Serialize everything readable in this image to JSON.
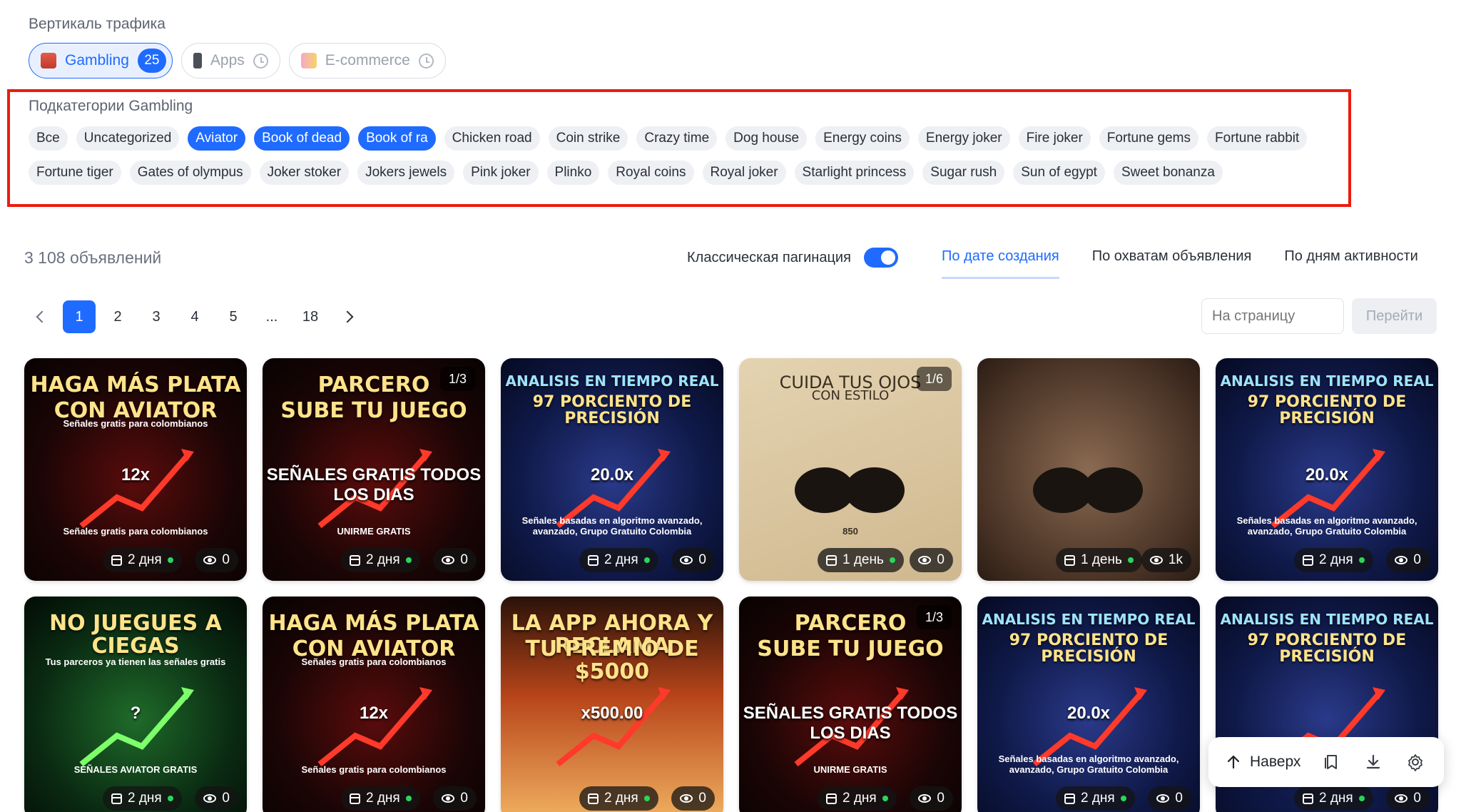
{
  "vertical": {
    "label": "Вертикаль трафика",
    "items": [
      {
        "label": "Gambling",
        "badge": "25",
        "active": true
      },
      {
        "label": "Apps",
        "active": false
      },
      {
        "label": "E-commerce",
        "active": false
      }
    ]
  },
  "subcategories": {
    "label": "Подкатегории Gambling",
    "row1": [
      "Все",
      "Uncategorized",
      "Aviator",
      "Book of dead",
      "Book of ra",
      "Chicken road",
      "Coin strike",
      "Crazy time",
      "Dog house",
      "Energy coins",
      "Energy joker",
      "Fire joker",
      "Fortune gems",
      "Fortune rabbit"
    ],
    "row2": [
      "Fortune tiger",
      "Gates of olympus",
      "Joker stoker",
      "Jokers jewels",
      "Pink joker",
      "Plinko",
      "Royal coins",
      "Royal joker",
      "Starlight princess",
      "Sugar rush",
      "Sun of egypt",
      "Sweet bonanza"
    ],
    "selected": [
      "Aviator",
      "Book of dead",
      "Book of ra"
    ]
  },
  "toolbar": {
    "count": "3 108 объявлений",
    "pagination_label": "Классическая пагинация",
    "pagination_on": true,
    "sort_tabs": [
      "По дате создания",
      "По охватам объявления",
      "По дням активности"
    ],
    "active_sort": "По дате создания"
  },
  "pager": {
    "pages": [
      "1",
      "2",
      "3",
      "4",
      "5",
      "...",
      "18"
    ],
    "current": "1",
    "goto_placeholder": "На страницу",
    "goto_button": "Перейти"
  },
  "cards": [
    {
      "theme": "red",
      "line1": "HAGA MÁS PLATA",
      "line2": "CON AVIATOR",
      "sub": "Señales gratis para colombianos",
      "big": "12x",
      "bottom": "Señales gratis para colombianos",
      "page": "",
      "days": "2 дня",
      "views": "0"
    },
    {
      "theme": "red",
      "line1": "PARCERO",
      "line2": "SUBE TU JUEGO",
      "sub": "",
      "big": "SEÑALES GRATIS TODOS LOS DIAS",
      "bottom": "UNIRME GRATIS",
      "page": "1/3",
      "days": "2 дня",
      "views": "0"
    },
    {
      "theme": "blue",
      "line1": "ANALISIS EN TIEMPO REAL",
      "line2": "97 PORCIENTO DE PRECISIÓN",
      "sub": "",
      "big": "20.0x",
      "bottom": "Señales basadas en algoritmo avanzado, avanzado, Grupo Gratuito Colombia",
      "page": "",
      "days": "2 дня",
      "views": "0"
    },
    {
      "theme": "beige",
      "line1": "CUIDA TUS OJOS",
      "line2": "CON ESTILO",
      "sub": "",
      "big": "",
      "bottom": "850",
      "page": "1/6",
      "days": "1 день",
      "views": "0"
    },
    {
      "theme": "brown",
      "line1": "",
      "line2": "",
      "sub": "",
      "big": "",
      "bottom": "",
      "page": "",
      "days": "1 день",
      "views": "1k"
    },
    {
      "theme": "blue",
      "line1": "ANALISIS EN TIEMPO REAL",
      "line2": "97 PORCIENTO DE PRECISIÓN",
      "sub": "",
      "big": "20.0x",
      "bottom": "Señales basadas en algoritmo avanzado, avanzado, Grupo Gratuito Colombia",
      "page": "",
      "days": "2 дня",
      "views": "0"
    },
    {
      "theme": "green",
      "line1": "NO JUEGUES A CIEGAS",
      "line2": "",
      "sub": "Tus parceros ya tienen las señales gratis",
      "big": "?",
      "bottom": "SEÑALES AVIATOR GRATIS",
      "page": "",
      "days": "2 дня",
      "views": "0"
    },
    {
      "theme": "red",
      "line1": "HAGA MÁS PLATA",
      "line2": "CON AVIATOR",
      "sub": "Señales gratis para colombianos",
      "big": "12x",
      "bottom": "Señales gratis para colombianos",
      "page": "",
      "days": "2 дня",
      "views": "0"
    },
    {
      "theme": "sky",
      "line1": "LA APP AHORA Y RECLAMA",
      "line2": "TU PREMIO DE $5000",
      "sub": "",
      "big": "x500.00",
      "bottom": "",
      "page": "",
      "days": "2 дня",
      "views": "0"
    },
    {
      "theme": "red",
      "line1": "PARCERO",
      "line2": "SUBE TU JUEGO",
      "sub": "",
      "big": "SEÑALES GRATIS TODOS LOS DIAS",
      "bottom": "UNIRME GRATIS",
      "page": "1/3",
      "days": "2 дня",
      "views": "0"
    },
    {
      "theme": "blue",
      "line1": "ANALISIS EN TIEMPO REAL",
      "line2": "97 PORCIENTO DE PRECISIÓN",
      "sub": "",
      "big": "20.0x",
      "bottom": "Señales basadas en algoritmo avanzado, avanzado, Grupo Gratuito Colombia",
      "page": "",
      "days": "2 дня",
      "views": "0"
    },
    {
      "theme": "blue",
      "line1": "ANALISIS EN TIEMPO REAL",
      "line2": "97 PORCIENTO DE PRECISIÓN",
      "sub": "",
      "big": "",
      "bottom": "",
      "page": "",
      "days": "2 дня",
      "views": "0"
    }
  ],
  "float_bar": {
    "up_label": "Наверх"
  },
  "colors": {
    "accent": "#1f6bff",
    "highlight": "#ec1c0e",
    "active_dot": "#2bd65a"
  }
}
